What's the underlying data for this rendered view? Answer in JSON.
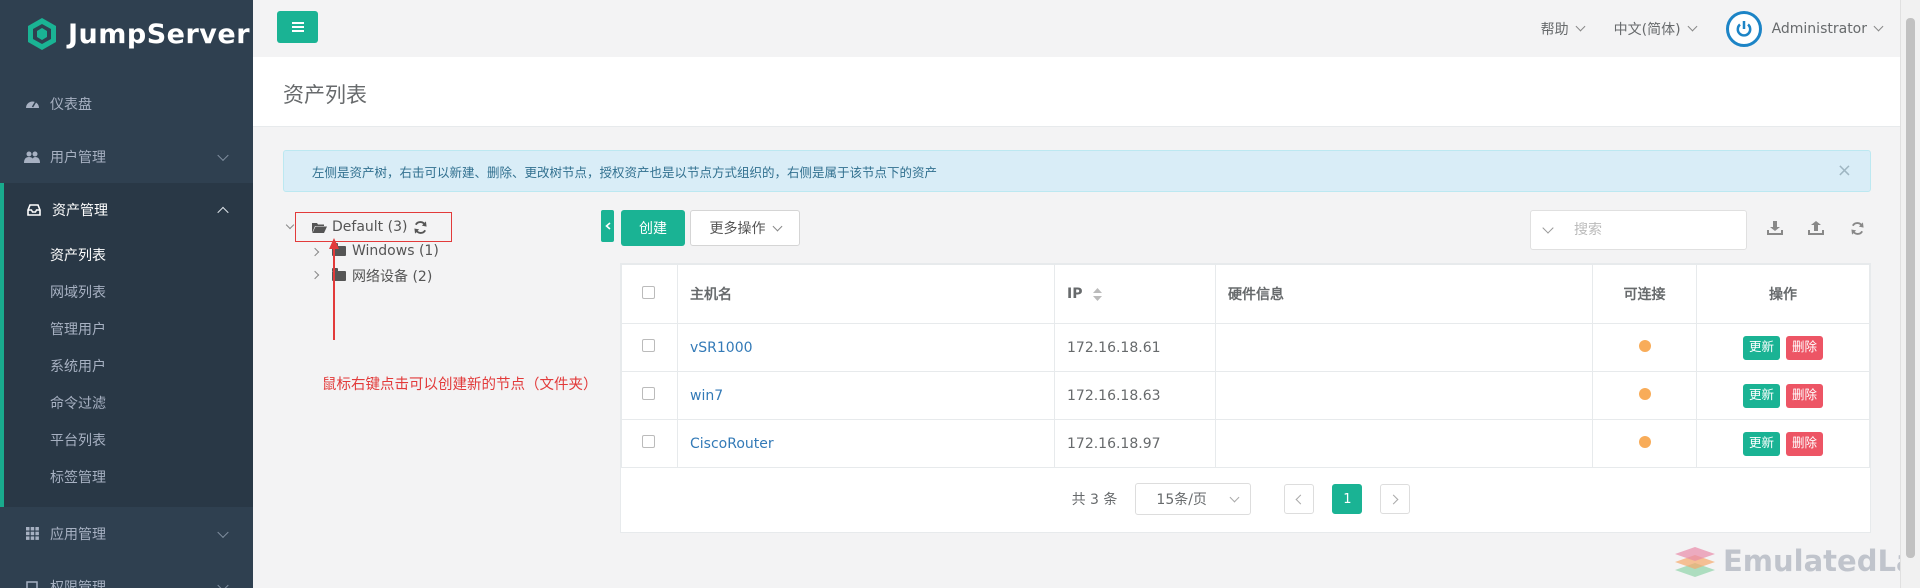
{
  "app": {
    "name": "JumpServer"
  },
  "sidebar": {
    "items": [
      {
        "label": "仪表盘",
        "icon": "dashboard-icon"
      },
      {
        "label": "用户管理",
        "icon": "users-icon"
      },
      {
        "label": "资产管理",
        "icon": "inbox-icon"
      },
      {
        "label": "应用管理",
        "icon": "grid-icon"
      },
      {
        "label": "权限管理",
        "icon": "edit-icon"
      }
    ],
    "asset_sub": [
      {
        "label": "资产列表"
      },
      {
        "label": "网域列表"
      },
      {
        "label": "管理用户"
      },
      {
        "label": "系统用户"
      },
      {
        "label": "命令过滤"
      },
      {
        "label": "平台列表"
      },
      {
        "label": "标签管理"
      }
    ]
  },
  "topbar": {
    "help": "帮助",
    "language": "中文(简体)",
    "user": "Administrator"
  },
  "page": {
    "title": "资产列表",
    "alert": "左侧是资产树，右击可以新建、删除、更改树节点，授权资产也是以节点方式组织的，右侧是属于该节点下的资产"
  },
  "tree": {
    "root": "Default (3)",
    "children": [
      "Windows (1)",
      "网络设备 (2)"
    ]
  },
  "annotation": "鼠标右键点击可以创建新的节点（文件夹）",
  "toolbar": {
    "create": "创建",
    "more": "更多操作",
    "search_placeholder": "搜索"
  },
  "table": {
    "headers": [
      "主机名",
      "IP",
      "硬件信息",
      "可连接",
      "操作"
    ],
    "rows": [
      {
        "hostname": "vSR1000",
        "ip": "172.16.18.61",
        "hardware": ""
      },
      {
        "hostname": "win7",
        "ip": "172.16.18.63",
        "hardware": ""
      },
      {
        "hostname": "CiscoRouter",
        "ip": "172.16.18.97",
        "hardware": ""
      }
    ],
    "update_label": "更新",
    "delete_label": "删除"
  },
  "pagination": {
    "total": "共 3 条",
    "page_size": "15条/页",
    "current_page": "1"
  },
  "watermark": "EmulatedLab",
  "colors": {
    "primary": "#1ab394",
    "sidebar": "#2f4050",
    "danger": "#ed5565",
    "warning": "#f8ac59",
    "link": "#337ab7"
  }
}
